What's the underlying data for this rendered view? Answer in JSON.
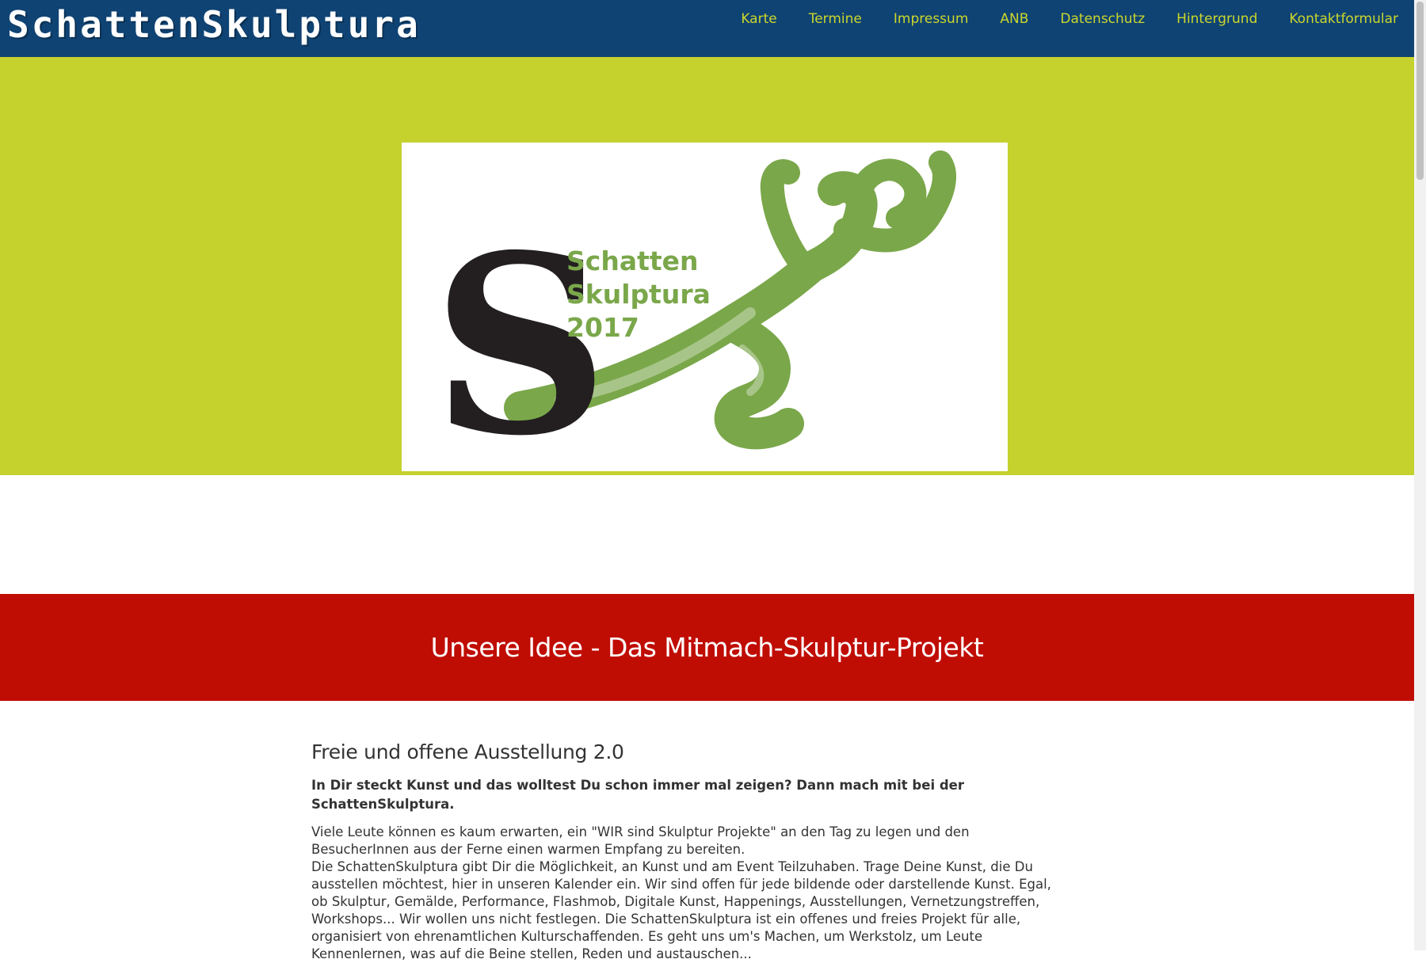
{
  "header": {
    "site_title": "SchattenSkulptura",
    "nav": [
      "Karte",
      "Termine",
      "Impressum",
      "ANB",
      "Datenschutz",
      "Hintergrund",
      "Kontaktformular"
    ]
  },
  "hero": {
    "logo_lines": [
      "Schatten",
      "Skulptura",
      "2017"
    ]
  },
  "section": {
    "title": "Unsere Idee - Das Mitmach-Skulptur-Projekt"
  },
  "content": {
    "heading": "Freie und offene Ausstellung 2.0",
    "lead": "In Dir steckt Kunst und das wolltest Du schon immer mal zeigen? Dann mach mit bei der SchattenSkulptura.",
    "paragraph_1": "Viele Leute können es kaum erwarten, ein \"WIR sind Skulptur Projekte\" an den Tag zu legen und den BesucherInnen aus der Ferne einen warmen Empfang zu bereiten.",
    "paragraph_2": "Die SchattenSkulptura gibt Dir die Möglichkeit, an Kunst und am Event Teilzuhaben. Trage Deine Kunst, die Du ausstellen möchtest, hier in unseren Kalender ein. Wir sind offen für jede bildende oder darstellende Kunst. Egal, ob Skulptur, Gemälde, Performance, Flashmob, Digitale Kunst, Happenings, Ausstellungen, Vernetzungstreffen, Workshops... Wir wollen uns nicht festlegen. Die SchattenSkulptura ist ein offenes und freies Projekt für alle, organisiert von ehrenamtlichen Kulturschaffenden. Es geht uns um's Machen, um Werkstolz, um Leute Kennenlernen, was auf die Beine stellen, Reden und austauschen..."
  },
  "colors": {
    "navbar": "#0f4373",
    "nav_link": "#cbd72c",
    "hero_bg": "#c5d12d",
    "section_band": "#c00d04",
    "logo_green": "#7aa74a"
  }
}
